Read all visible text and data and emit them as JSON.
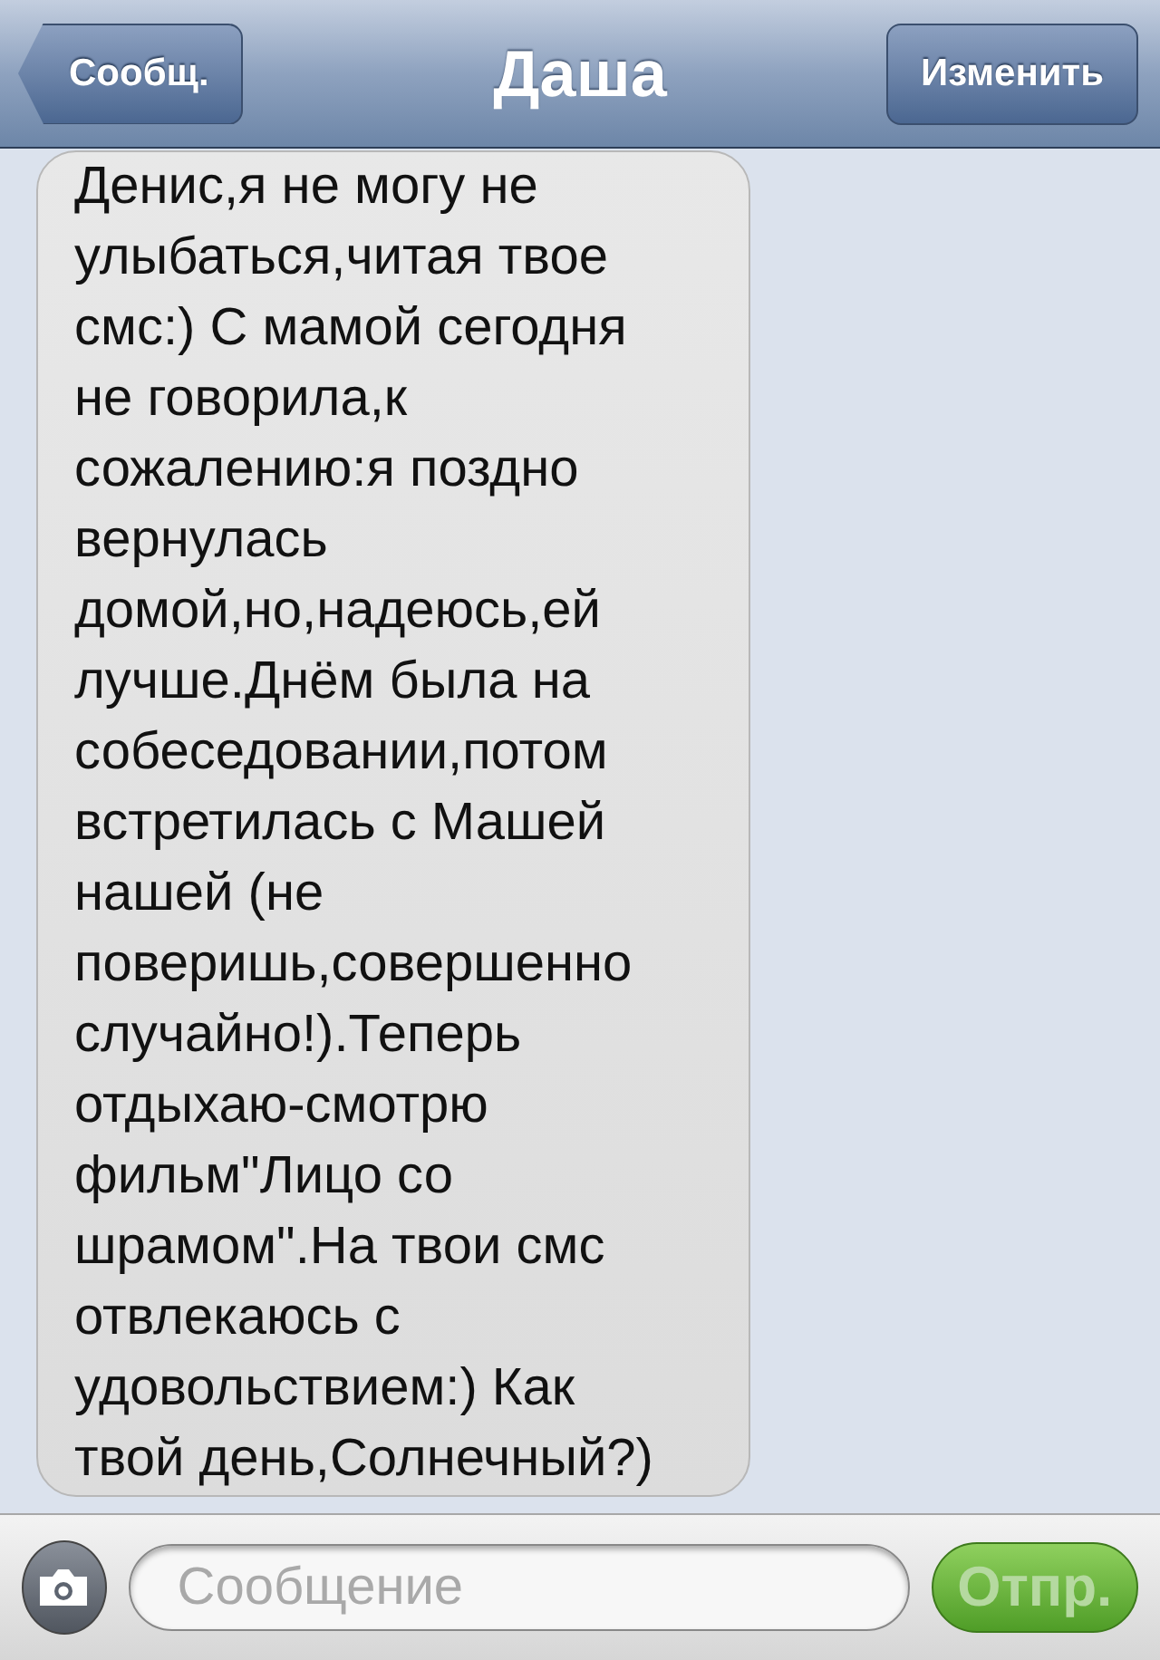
{
  "nav_bar": {
    "back_button": "Сообщ.",
    "title": "Даша",
    "edit_button": "Изменить"
  },
  "messages": [
    {
      "kind": "incoming",
      "text": "Денис,я не могу не\nулыбаться,читая твое\nсмс:) С мамой сегодня\nне говорила,к\nсожалению:я поздно\nвернулась\nдомой,но,надеюсь,ей\nлучше.Днём была на\nсобеседовании,потом\nвстретилась с Машей\nнашей (не\nповеришь,совершенно\nслучайно!).Теперь\nотдыхаю-смотрю\nфильм\"Лицо со\nшрамом\".На твои смс\nотвлекаюсь с\nудовольствием:) Как\nтвой день,Солнечный?)"
    }
  ],
  "compose_bar": {
    "placeholder": "Сообщение",
    "send_button": {
      "label": "Отпр.",
      "disabled": true
    }
  }
}
